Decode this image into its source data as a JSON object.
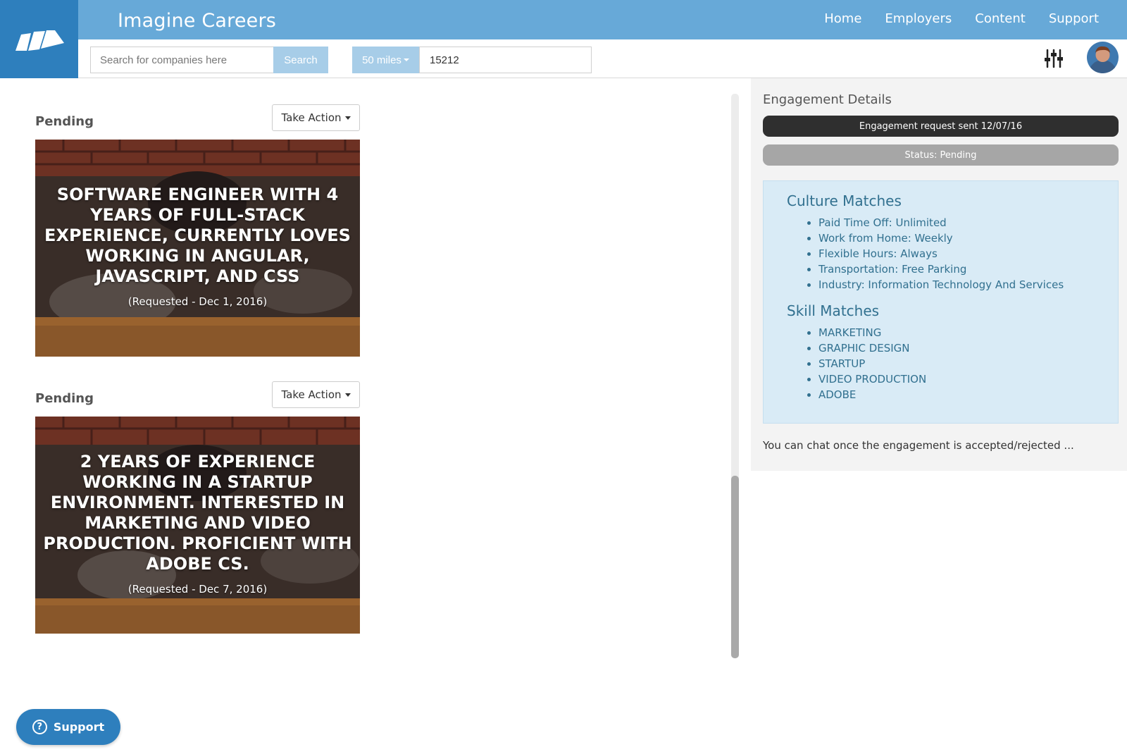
{
  "app": {
    "brand": "Imagine Careers",
    "nav": [
      "Home",
      "Employers",
      "Content",
      "Support"
    ]
  },
  "search": {
    "placeholder": "Search for companies here",
    "button_label": "Search",
    "radius_label": "50 miles",
    "zip_value": "15212"
  },
  "icons": {
    "logo": "book-logo-icon",
    "filter": "sliders-icon",
    "avatar": "user-avatar",
    "support": "question-circle-icon",
    "dropdown": "caret-down-icon"
  },
  "engagements": [
    {
      "status": "Pending",
      "action_label": "Take Action",
      "title": "Software Engineer with 4 years of full-stack experience, currently loves working in Angular, JavaScript, and CSS",
      "requested": "(Requested - Dec 1, 2016)"
    },
    {
      "status": "Pending",
      "action_label": "Take Action",
      "title": "2 years of experience working in a startup environment. Interested in marketing and video production. Proficient with Adobe CS.",
      "requested": "(Requested - Dec 7, 2016)"
    }
  ],
  "details": {
    "title": "Engagement Details",
    "request_sent": "Engagement request sent 12/07/16",
    "status": "Status: Pending",
    "culture_title": "Culture Matches",
    "culture": [
      "Paid Time Off: Unlimited",
      "Work from Home: Weekly",
      "Flexible Hours: Always",
      "Transportation: Free Parking",
      "Industry: Information Technology And Services"
    ],
    "skill_title": "Skill Matches",
    "skills": [
      "MARKETING",
      "GRAPHIC DESIGN",
      "STARTUP",
      "VIDEO PRODUCTION",
      "ADOBE"
    ],
    "chat_note": "You can chat once the engagement is accepted/rejected ..."
  },
  "support_button": "Support",
  "colors": {
    "header": "#67a9d8",
    "logo_bg": "#2e7fbd",
    "button_light": "#a7cde8",
    "matches_bg": "#d9ebf6",
    "matches_text": "#31708f"
  }
}
